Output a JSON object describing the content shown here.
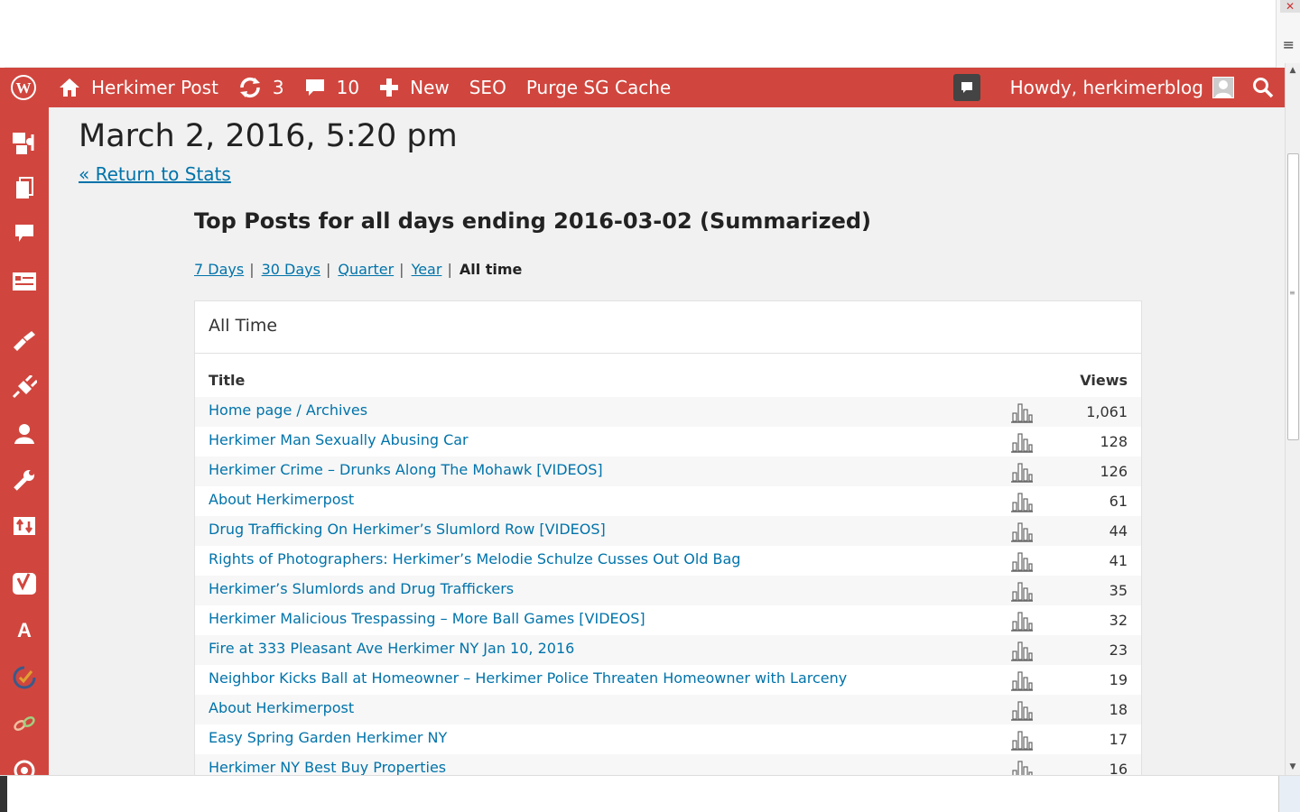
{
  "colors": {
    "accent": "#d0463e",
    "link": "#0073aa",
    "background": "#f1f1f1"
  },
  "adminbar": {
    "site_name": "Herkimer Post",
    "updates_count": "3",
    "comments_count": "10",
    "new_label": "New",
    "seo_label": "SEO",
    "purge_label": "Purge SG Cache",
    "howdy": "Howdy, herkimerblog"
  },
  "sidebar": {
    "icons": [
      "media-icon",
      "pages-icon",
      "comments-icon",
      "feedback-icon",
      "appearance-icon",
      "plugins-icon",
      "users-icon",
      "tools-icon",
      "settings-icon",
      "yoast-icon",
      "font-icon",
      "performance-icon",
      "links-icon",
      "extra-icon"
    ]
  },
  "page": {
    "date": "March 2, 2016, 5:20 pm",
    "return_link": "« Return to Stats",
    "title": "Top Posts for all days ending 2016-03-02 (Summarized)"
  },
  "periods": {
    "p7": "7 Days",
    "p30": "30 Days",
    "quarter": "Quarter",
    "year": "Year",
    "current": "All time"
  },
  "card": {
    "heading": "All Time",
    "col_title": "Title",
    "col_views": "Views"
  },
  "rows": [
    {
      "title": "Home page / Archives",
      "views": "1,061"
    },
    {
      "title": "Herkimer Man Sexually Abusing Car",
      "views": "128"
    },
    {
      "title": "Herkimer Crime – Drunks Along The Mohawk [VIDEOS]",
      "views": "126"
    },
    {
      "title": "About Herkimerpost",
      "views": "61"
    },
    {
      "title": "Drug Trafficking On Herkimer’s Slumlord Row [VIDEOS]",
      "views": "44"
    },
    {
      "title": "Rights of Photographers: Herkimer’s Melodie Schulze Cusses Out Old Bag",
      "views": "41"
    },
    {
      "title": "Herkimer’s Slumlords and Drug Traffickers",
      "views": "35"
    },
    {
      "title": "Herkimer Malicious Trespassing – More Ball Games [VIDEOS]",
      "views": "32"
    },
    {
      "title": "Fire at 333 Pleasant Ave Herkimer NY Jan 10, 2016",
      "views": "23"
    },
    {
      "title": "Neighbor Kicks Ball at Homeowner – Herkimer Police Threaten Homeowner with Larceny",
      "views": "19"
    },
    {
      "title": "About Herkimerpost",
      "views": "18"
    },
    {
      "title": "Easy Spring Garden Herkimer NY",
      "views": "17"
    },
    {
      "title": "Herkimer NY Best Buy Properties",
      "views": "16"
    }
  ]
}
